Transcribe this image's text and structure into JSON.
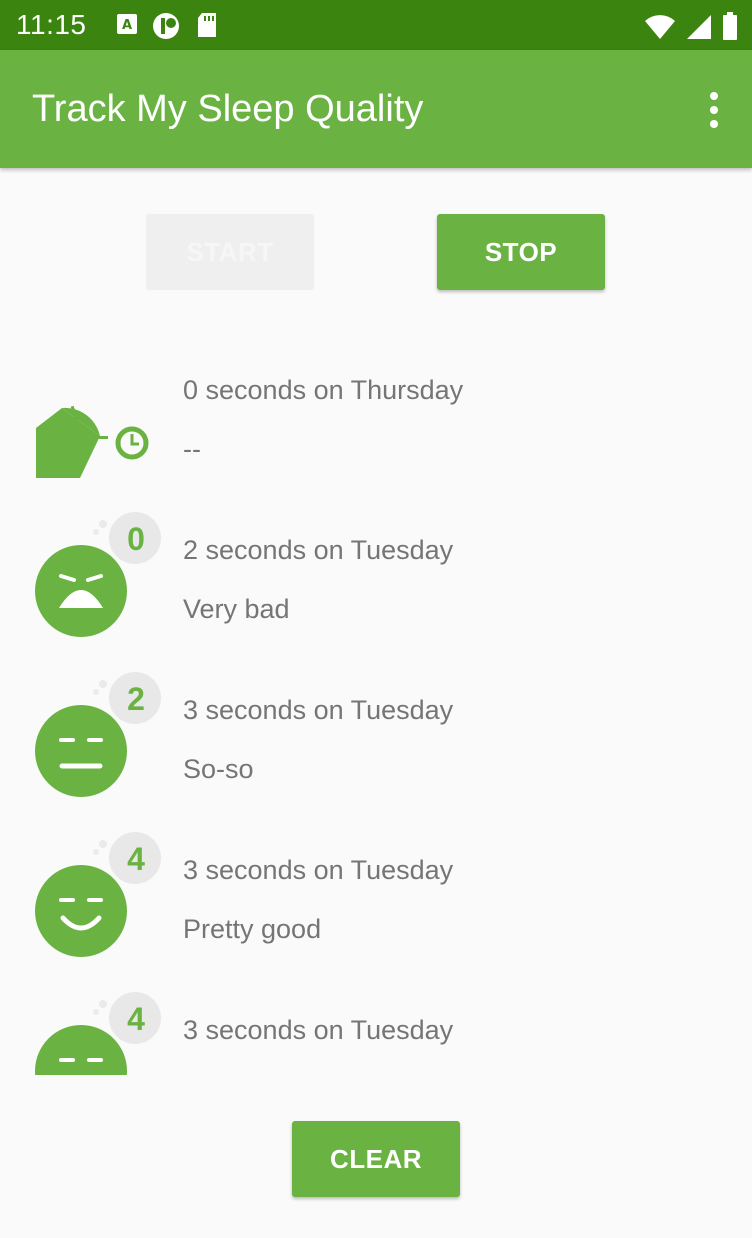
{
  "status_bar": {
    "time": "11:15"
  },
  "app_bar": {
    "title": "Track My Sleep Quality",
    "menu_icon": "more-vert-icon"
  },
  "controls": {
    "start_label": "START",
    "stop_label": "STOP",
    "clear_label": "CLEAR"
  },
  "colors": {
    "primary": "#6ab343",
    "primary_dark": "#3c8410",
    "text_secondary": "#757575"
  },
  "nights": [
    {
      "duration_text": "0 seconds on Thursday",
      "quality_text": "--",
      "icon": "active-sleep-clock-icon",
      "rating": ""
    },
    {
      "duration_text": "2 seconds on Tuesday",
      "quality_text": "Very bad",
      "icon": "very-bad-face-icon",
      "rating": "0"
    },
    {
      "duration_text": "3 seconds on Tuesday",
      "quality_text": "So-so",
      "icon": "so-so-face-icon",
      "rating": "2"
    },
    {
      "duration_text": "3 seconds on Tuesday",
      "quality_text": "Pretty good",
      "icon": "pretty-good-face-icon",
      "rating": "4"
    },
    {
      "duration_text": "3 seconds on Tuesday",
      "quality_text": "",
      "icon": "face-icon",
      "rating": "4"
    }
  ]
}
